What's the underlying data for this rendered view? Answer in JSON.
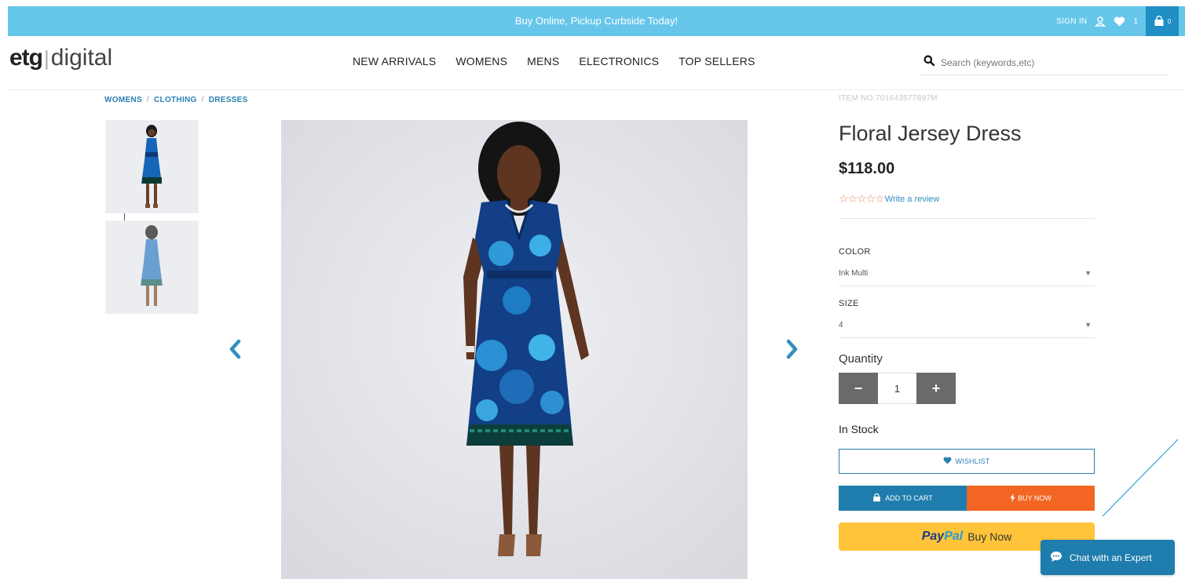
{
  "promo": {
    "text": "Buy Online, Pickup Curbside Today!",
    "sign_in": "SIGN IN",
    "wishlist_count": "1",
    "cart_count": "0"
  },
  "header": {
    "logo_etg": "etg",
    "logo_digital": "digital",
    "nav": [
      "NEW ARRIVALS",
      "WOMENS",
      "MENS",
      "ELECTRONICS",
      "TOP SELLERS"
    ],
    "search_placeholder": "Search (keywords,etc)"
  },
  "breadcrumb": [
    "WOMENS",
    "CLOTHING",
    "DRESSES"
  ],
  "product": {
    "item_no": "ITEM NO.701643577897M",
    "title": "Floral Jersey Dress",
    "price": "$118.00",
    "stars": "☆☆☆☆☆",
    "write_review": "Write a review",
    "color_label": "COLOR",
    "color_value": "Ink Multi",
    "size_label": "SIZE",
    "size_value": "4",
    "quantity_label": "Quantity",
    "quantity_minus": "−",
    "quantity": "1",
    "quantity_plus": "+",
    "stock": "In Stock",
    "wishlist": "WISHLIST",
    "add_to_cart": "ADD TO CART",
    "buy_now": "BUY NOW",
    "paypal_pay": "Pay",
    "paypal_pal": "Pal",
    "paypal_buy": "Buy Now"
  },
  "chat": {
    "label": "Chat with an Expert"
  },
  "colors": {
    "promo_bar": "#66c6ea",
    "accent_blue": "#1f7dad",
    "buy_now_orange": "#f26522",
    "paypal_yellow": "#ffc439",
    "dress_blue": "#1565b8"
  },
  "icons": [
    "user-icon",
    "heart-icon",
    "bag-icon",
    "search-icon",
    "chevron-left-icon",
    "chevron-right-icon",
    "caret-down-icon",
    "chat-bubble-icon",
    "bolt-icon"
  ]
}
